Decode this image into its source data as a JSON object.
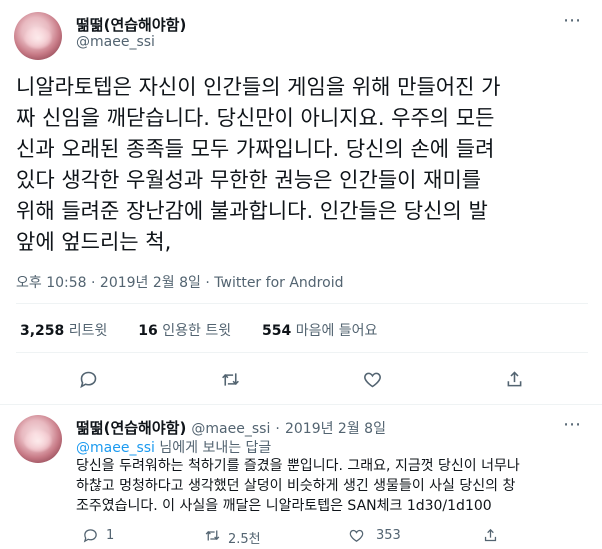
{
  "tweet": {
    "display_name": "떪떪(연습해야함)",
    "handle": "@maee_ssi",
    "text": "니알라토텝은 자신이 인간들의 게임을 위해 만들어진 가\n짜 신임을 깨닫습니다. 당신만이 아니지요. 우주의 모든\n신과 오래된 종족들 모두 가짜입니다. 당신의 손에 들려\n있다 생각한 우월성과 무한한 권능은 인간들이 재미를\n위해 들려준 장난감에 불과합니다. 인간들은 당신의 발\n앞에 엎드리는 척,",
    "time": "오후 10:58",
    "date": "2019년 2월 8일",
    "source": "Twitter for Android",
    "separator": "·",
    "stats": {
      "retweets_num": "3,258",
      "retweets_label": "리트윗",
      "quotes_num": "16",
      "quotes_label": "인용한 트윗",
      "likes_num": "554",
      "likes_label": "마음에 들어요"
    },
    "actions": [
      "reply-icon",
      "retweet-icon",
      "like-icon",
      "share-icon"
    ]
  },
  "reply": {
    "display_name": "떪떪(연습해야함)",
    "handle": "@maee_ssi",
    "date": "2019년 2월 8일",
    "separator": "·",
    "replying_to_handle": "@maee_ssi",
    "replying_to_suffix": "님에게 보내는 답글",
    "text": "당신을 두려워하는 척하기를 즐겼을 뿐입니다. 그래요, 지금껏 당신이 너무나\n하찮고 멍청하다고 생각했던 살덩이 비슷하게 생긴 생물들이 사실 당신의 창\n조주였습니다. 이 사실을 깨달은 니알라토텝은 SAN체크 1d30/1d100",
    "counts": {
      "replies": "1",
      "retweets": "2.5천",
      "likes": "353"
    }
  },
  "colors": {
    "accent": "#1d9bf0",
    "text": "#0f1419",
    "secondary": "#536471",
    "divider": "#eff3f4"
  }
}
